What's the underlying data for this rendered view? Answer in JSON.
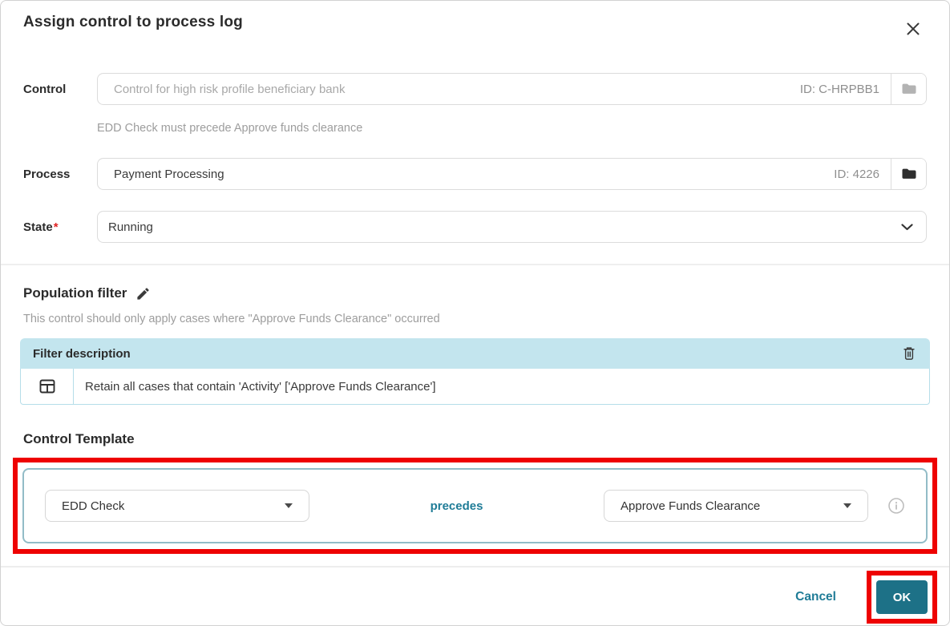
{
  "modal": {
    "title": "Assign control to process log"
  },
  "form": {
    "control": {
      "label": "Control",
      "placeholder": "Control for high risk profile beneficiary bank",
      "id_text": "ID: C-HRPBB1",
      "helper": "EDD Check must precede Approve funds clearance"
    },
    "process": {
      "label": "Process",
      "value": "Payment Processing",
      "id_text": "ID: 4226"
    },
    "state": {
      "label": "State",
      "required_mark": "*",
      "value": "Running"
    }
  },
  "population_filter": {
    "heading": "Population filter",
    "description": "This control should only apply cases where \"Approve Funds Clearance\" occurred",
    "table": {
      "header": "Filter description",
      "rows": [
        {
          "text": "Retain all cases that contain 'Activity' ['Approve Funds Clearance']"
        }
      ]
    }
  },
  "control_template": {
    "heading": "Control Template",
    "left_activity": "EDD Check",
    "relation": "precedes",
    "right_activity": "Approve Funds Clearance"
  },
  "footer": {
    "cancel_label": "Cancel",
    "ok_label": "OK"
  },
  "icons": {
    "close": "✕",
    "folder": "🗀",
    "chevron_down": "⌄",
    "pencil": "✎",
    "trash": "🗑",
    "table": "⊞",
    "caret_down": "▼",
    "info": "ⓘ"
  },
  "colors": {
    "accent_teal": "#1f7c97",
    "ok_button_bg": "#1d7187",
    "filter_header_bg": "#c3e5ee",
    "annotation_red": "#ee0202"
  }
}
